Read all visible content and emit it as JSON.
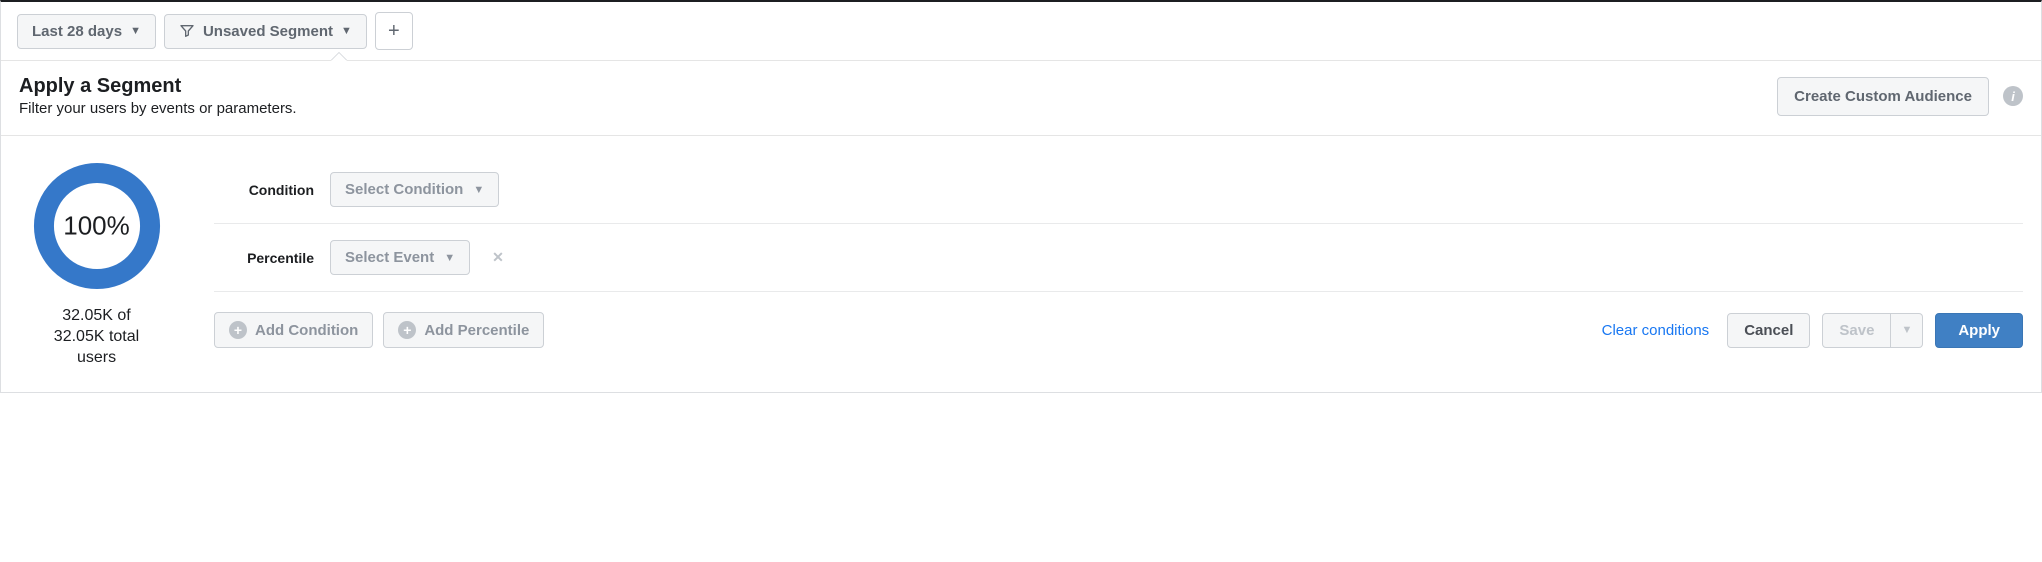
{
  "toolbar": {
    "date_range_label": "Last 28 days",
    "segment_label": "Unsaved Segment"
  },
  "header": {
    "title": "Apply a Segment",
    "subtitle": "Filter your users by events or parameters.",
    "create_audience_label": "Create Custom Audience"
  },
  "chart_data": {
    "type": "pie",
    "series": [
      {
        "name": "Selected",
        "value": 100
      }
    ],
    "percent_label": "100%",
    "caption_line1": "32.05K of",
    "caption_line2": "32.05K total",
    "caption_line3": "users",
    "color": "#3578c9"
  },
  "conditions": {
    "condition_label": "Condition",
    "condition_select_placeholder": "Select Condition",
    "percentile_label": "Percentile",
    "percentile_select_placeholder": "Select Event"
  },
  "actions": {
    "add_condition_label": "Add Condition",
    "add_percentile_label": "Add Percentile",
    "clear_label": "Clear conditions",
    "cancel_label": "Cancel",
    "save_label": "Save",
    "apply_label": "Apply"
  }
}
